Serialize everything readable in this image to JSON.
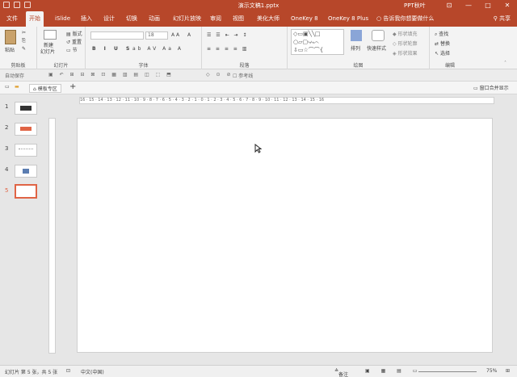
{
  "app": {
    "document_title": "演示文稿1.pptx",
    "account_name": "PPT秋叶",
    "window_controls": [
      "—",
      "□",
      "✕"
    ]
  },
  "tabs": [
    {
      "label": "文件"
    },
    {
      "label": "开始",
      "active": true
    },
    {
      "label": "iSlide"
    },
    {
      "label": "插入"
    },
    {
      "label": "设计"
    },
    {
      "label": "切换"
    },
    {
      "label": "动画"
    },
    {
      "label": "幻灯片放映"
    },
    {
      "label": "审阅"
    },
    {
      "label": "视图"
    },
    {
      "label": "美化大师"
    },
    {
      "label": "OneKey 8"
    },
    {
      "label": "OneKey 8 Plus"
    }
  ],
  "tell_me": "告诉我你想要做什么",
  "share_label": "共享",
  "ribbon": {
    "clipboard": {
      "paste": "粘贴",
      "label": "剪贴板"
    },
    "slides": {
      "new_slide_line1": "新建",
      "new_slide_line2": "幻灯片",
      "layout": "版式",
      "reset": "重置",
      "section": "节",
      "label": "幻灯片"
    },
    "font": {
      "size": "18",
      "label": "字体"
    },
    "paragraph": {
      "label": "段落"
    },
    "drawing": {
      "arrange": "排列",
      "quick_styles": "快速样式",
      "shape_fill": "形状填充",
      "shape_outline": "形状轮廓",
      "shape_effects": "形状效果",
      "label": "绘图"
    },
    "editing": {
      "find": "查找",
      "replace": "替换",
      "select": "选择",
      "label": "编辑"
    }
  },
  "quickbar": {
    "auto_save": "自动保存",
    "guides": "参考线"
  },
  "template_tab": {
    "label": "模板专区",
    "window_merge": "窗口合并显示"
  },
  "ruler_text": "16 · 15 · 14 · 13 · 12 · 11 · 10 · 9 · 8 · 7 · 6 · 5 · 4 · 3 · 2 · 1 · 0 · 1 · 2 · 3 · 4 · 5 · 6 · 7 · 8 · 9 · 10 · 11 · 12 · 13 · 14 · 15 · 16",
  "slides": [
    {
      "number": "1"
    },
    {
      "number": "2"
    },
    {
      "number": "3"
    },
    {
      "number": "4"
    },
    {
      "number": "5",
      "selected": true
    }
  ],
  "status": {
    "slide_info": "幻灯片 第 5 张，共 5 张",
    "language": "中文(中国)",
    "notes": "备注",
    "zoom": "75%"
  },
  "colors": {
    "accent": "#b7472a",
    "selection": "#e06445"
  }
}
